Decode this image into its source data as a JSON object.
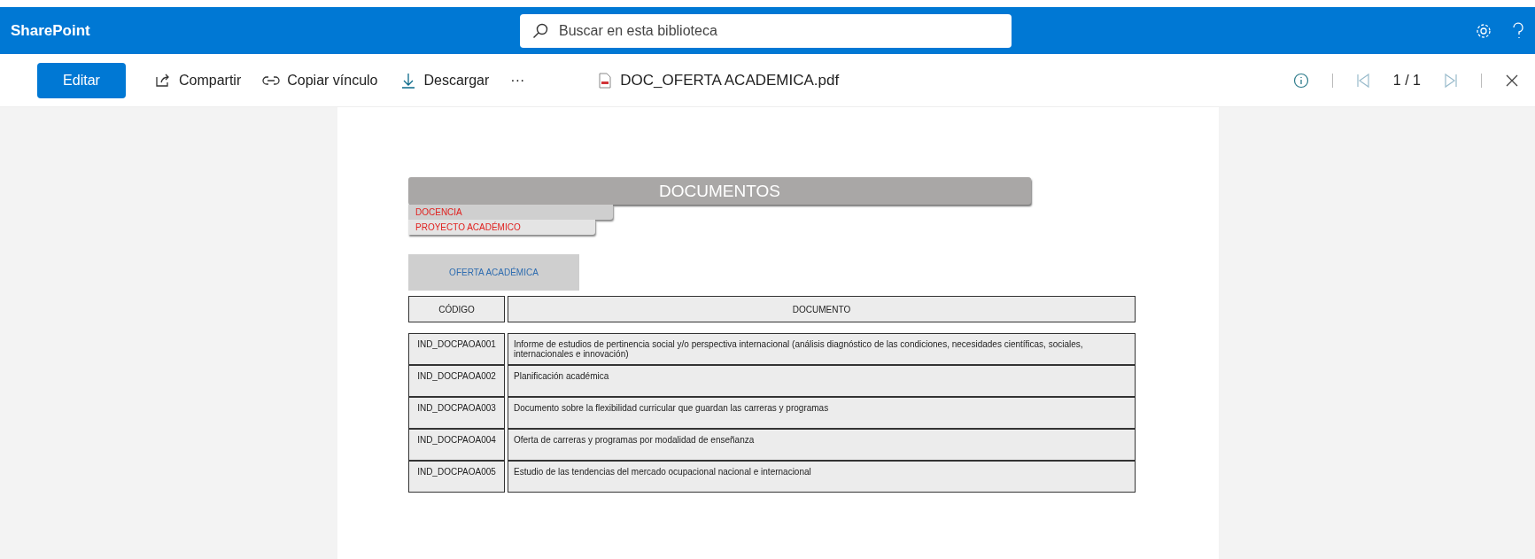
{
  "header": {
    "brand": "SharePoint",
    "search": {
      "placeholder": "Buscar en esta biblioteca"
    }
  },
  "toolbar": {
    "edit": "Editar",
    "actions": [
      {
        "kind": "share",
        "label": "Compartir"
      },
      {
        "kind": "link",
        "label": "Copiar vínculo"
      },
      {
        "kind": "download",
        "label": "Descargar"
      },
      {
        "kind": "more",
        "label": "···"
      }
    ],
    "file_name": "DOC_OFERTA ACADEMICA.pdf",
    "page": "1 / 1"
  },
  "document": {
    "title": "DOCUMENTOS",
    "tabs": [
      "DOCENCIA",
      "PROYECTO ACADÉMICO"
    ],
    "section": "OFERTA ACADÉMICA",
    "table": {
      "columns": [
        "CÓDIGO",
        "DOCUMENTO"
      ],
      "rows": [
        [
          "IND_DOCPAOA001",
          "Informe de estudios de pertinencia social y/o perspectiva internacional (análisis diagnóstico de las condiciones, necesidades científicas, sociales, internacionales e innovación)"
        ],
        [
          "IND_DOCPAOA002",
          "Planificación académica"
        ],
        [
          "IND_DOCPAOA003",
          "Documento sobre la flexibilidad curricular que guardan las carreras y programas"
        ],
        [
          "IND_DOCPAOA004",
          "Oferta de carreras y programas por modalidad de enseñanza"
        ],
        [
          "IND_DOCPAOA005",
          "Estudio de las tendencias del mercado ocupacional nacional e internacional"
        ]
      ]
    }
  }
}
